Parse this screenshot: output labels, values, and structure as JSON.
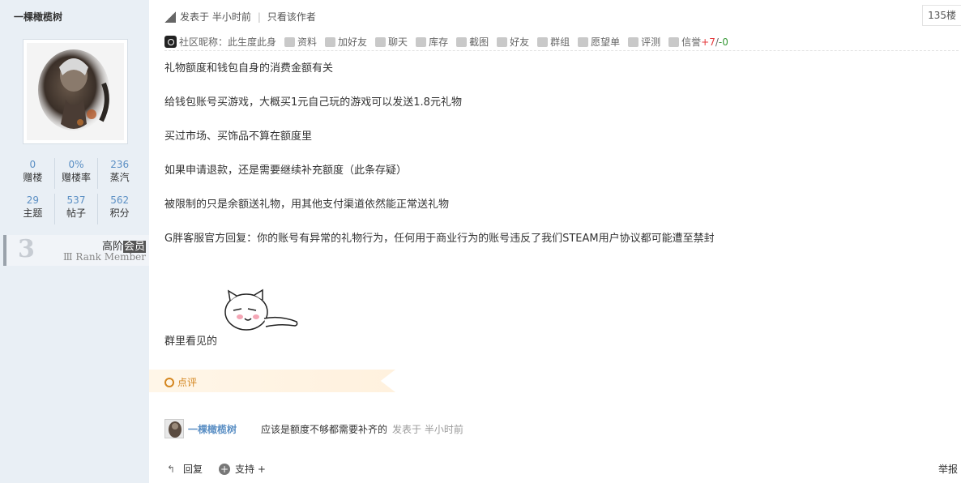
{
  "user": {
    "name": "一棵橄榄树",
    "stats": [
      [
        {
          "num": "0",
          "label": "赠楼"
        },
        {
          "num": "0%",
          "label": "赠楼率"
        },
        {
          "num": "236",
          "label": "蒸汽"
        }
      ],
      [
        {
          "num": "29",
          "label": "主题"
        },
        {
          "num": "537",
          "label": "帖子"
        },
        {
          "num": "562",
          "label": "积分"
        }
      ]
    ],
    "rank": {
      "level_glyph": "3",
      "title_prefix": "高阶",
      "title_highlight": "会员",
      "subtitle": "Ⅲ Rank Member"
    }
  },
  "post": {
    "meta_posted": "发表于 半小时前",
    "meta_separator": "|",
    "meta_author_only": "只看该作者",
    "floor": "135楼",
    "toolbar": {
      "nickname": "社区昵称：此生度此身",
      "items": [
        "资料",
        "加好友",
        "聊天",
        "库存",
        "截图",
        "好友",
        "群组",
        "愿望单",
        "评测",
        "信誉"
      ],
      "reputation_plus": "+7",
      "reputation_slash": "/",
      "reputation_minus": "-0"
    },
    "paragraphs": [
      "礼物额度和钱包自身的消费金额有关",
      "给钱包账号买游戏，大概买1元自己玩的游戏可以发送1.8元礼物",
      "买过市场、买饰品不算在额度里",
      "如果申请退款，还是需要继续补充额度（此条存疑）",
      "被限制的只是余额送礼物，用其他支付渠道依然能正常送礼物",
      "G胖客服官方回复：你的账号有异常的礼物行为，任何用于商业行为的账号违反了我们STEAM用户协议都可能遭至禁封"
    ],
    "after_sticker": "群里看见的",
    "review_label": "点评",
    "comment": {
      "name": "一棵橄榄树",
      "text": "应该是额度不够都需要补齐的",
      "time": "发表于 半小时前"
    },
    "actions": {
      "reply": "回复",
      "support": "支持 +",
      "report": "举报"
    }
  }
}
